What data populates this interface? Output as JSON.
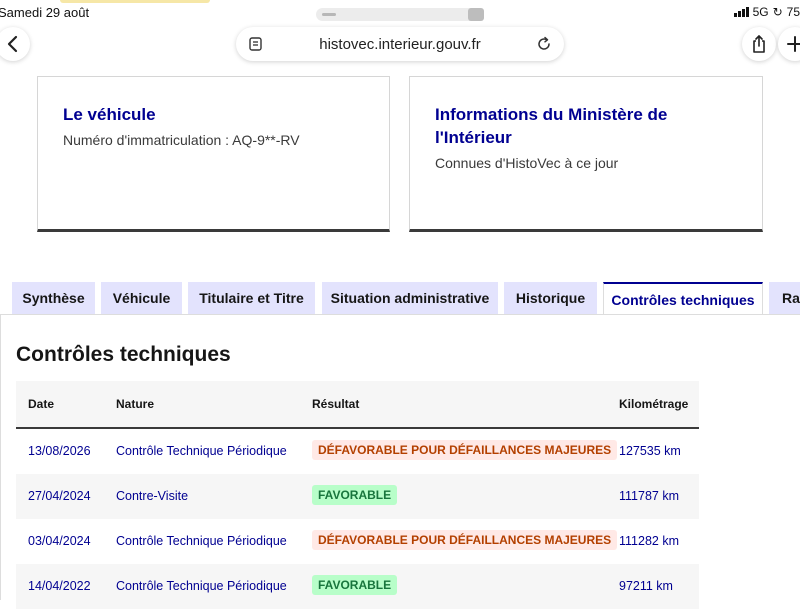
{
  "status_bar": {
    "date": "Samedi 29 août",
    "network": "5G",
    "battery": "75"
  },
  "browser": {
    "url": "histovec.interieur.gouv.fr",
    "back_icon": "chevron-left-icon",
    "reader_icon": "reader-icon",
    "reload_icon": "reload-icon",
    "share_icon": "share-icon",
    "plus_icon": "plus-icon"
  },
  "cards": {
    "vehicule": {
      "title": "Le véhicule",
      "description": "Numéro d'immatriculation : AQ-9**-RV"
    },
    "ministere": {
      "title": "Informations du Ministère de l'Intérieur",
      "description": "Connues d'HistoVec à ce jour"
    }
  },
  "tabs": [
    {
      "label": "Synthèse",
      "active": false
    },
    {
      "label": "Véhicule",
      "active": false
    },
    {
      "label": "Titulaire et Titre",
      "active": false
    },
    {
      "label": "Situation administrative",
      "active": false
    },
    {
      "label": "Historique",
      "active": false
    },
    {
      "label": "Contrôles techniques",
      "active": true
    },
    {
      "label": "Rap",
      "active": false
    }
  ],
  "section": {
    "title": "Contrôles techniques"
  },
  "table": {
    "headers": {
      "date": "Date",
      "nature": "Nature",
      "result": "Résultat",
      "km": "Kilométrage"
    },
    "rows": [
      {
        "date": "13/08/2026",
        "nature": "Contrôle Technique Périodique",
        "result": "DÉFAVORABLE POUR DÉFAILLANCES MAJEURES",
        "result_status": "unfavorable",
        "km": "127535 km"
      },
      {
        "date": "27/04/2024",
        "nature": "Contre-Visite",
        "result": "FAVORABLE",
        "result_status": "favorable",
        "km": "111787 km"
      },
      {
        "date": "03/04/2024",
        "nature": "Contrôle Technique Périodique",
        "result": "DÉFAVORABLE POUR DÉFAILLANCES MAJEURES",
        "result_status": "unfavorable",
        "km": "111282 km"
      },
      {
        "date": "14/04/2022",
        "nature": "Contrôle Technique Périodique",
        "result": "FAVORABLE",
        "result_status": "favorable",
        "km": "97211 km"
      }
    ]
  },
  "colors": {
    "accent": "#000091",
    "tab_bg": "#e3e3fd",
    "unfavorable_bg": "#ffe9e6",
    "unfavorable_text": "#b34000",
    "favorable_bg": "#b8fec9",
    "favorable_text": "#18753c"
  }
}
